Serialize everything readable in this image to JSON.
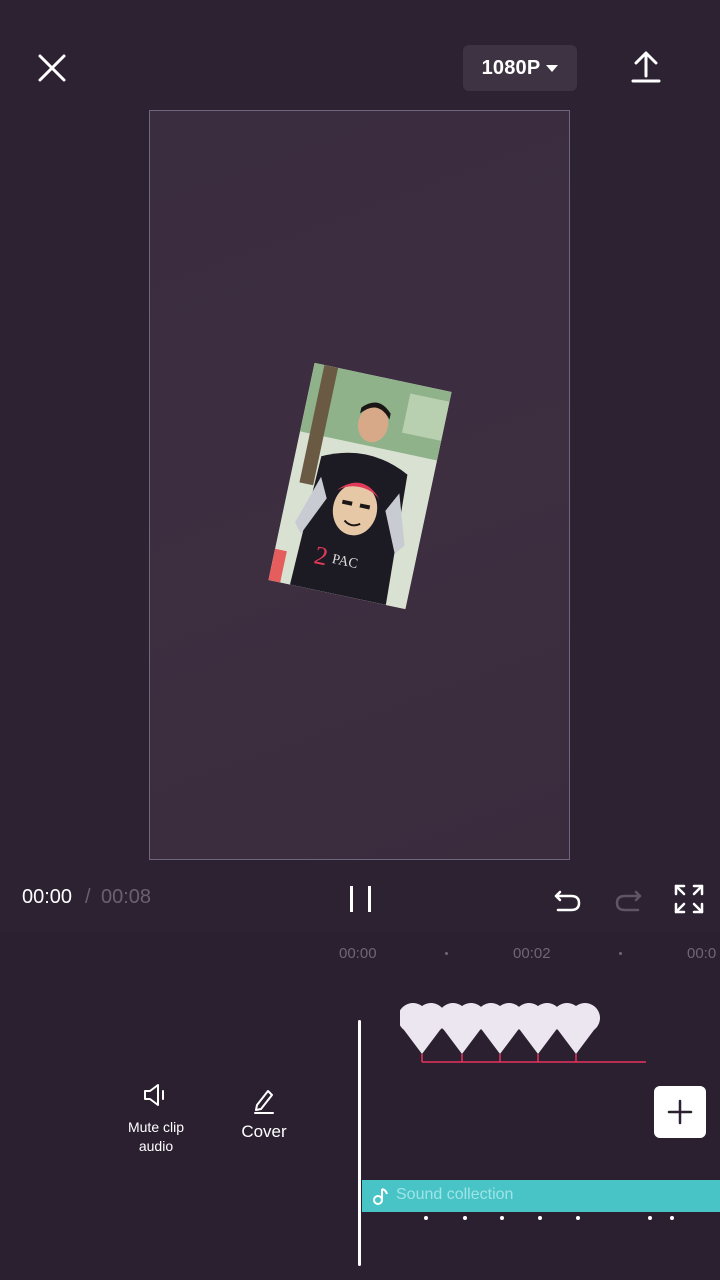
{
  "topbar": {
    "resolution_label": "1080P"
  },
  "playback": {
    "current_time": "00:00",
    "separator": "/",
    "total_time": "00:08"
  },
  "ruler": {
    "marks": [
      "00:00",
      "00:02",
      "00:0"
    ]
  },
  "tools": {
    "mute_label": "Mute clip\naudio",
    "cover_label": "Cover"
  },
  "audio": {
    "label": "Sound collection",
    "color": "#48c4c6"
  },
  "colors": {
    "background": "#2d2232",
    "canvas": "#3a2d3f",
    "accent_red": "#e8335e"
  }
}
